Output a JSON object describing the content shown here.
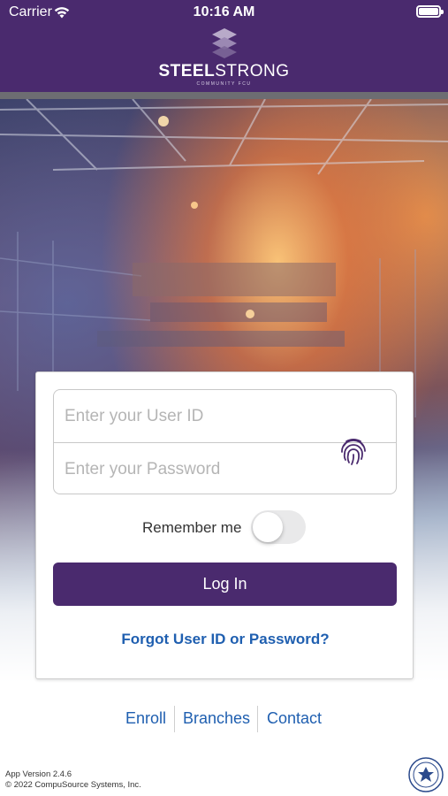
{
  "status_bar": {
    "carrier": "Carrier",
    "time": "10:16 AM",
    "wifi_icon": "wifi-icon",
    "battery_icon": "battery-icon"
  },
  "header": {
    "logo_text_bold": "STEEL",
    "logo_text_light": "STRONG",
    "logo_subtitle": "COMMUNITY FCU",
    "background_color": "#4a2a6e"
  },
  "login_form": {
    "user_id_placeholder": "Enter your User ID",
    "user_id_value": "",
    "password_placeholder": "Enter your Password",
    "password_value": "",
    "biometric_icon": "fingerprint-icon",
    "remember_label": "Remember me",
    "remember_on": false,
    "login_label": "Log In",
    "forgot_label": "Forgot User ID or Password?"
  },
  "footer_links": {
    "enroll": "Enroll",
    "branches": "Branches",
    "contact": "Contact"
  },
  "footer": {
    "version": "App Version 2.4.6",
    "copyright": "© 2022 CompuSource Systems, Inc.",
    "seal_icon": "ncua-seal-icon"
  },
  "colors": {
    "brand_purple": "#4a2a6e",
    "link_blue": "#1f5fb0"
  }
}
